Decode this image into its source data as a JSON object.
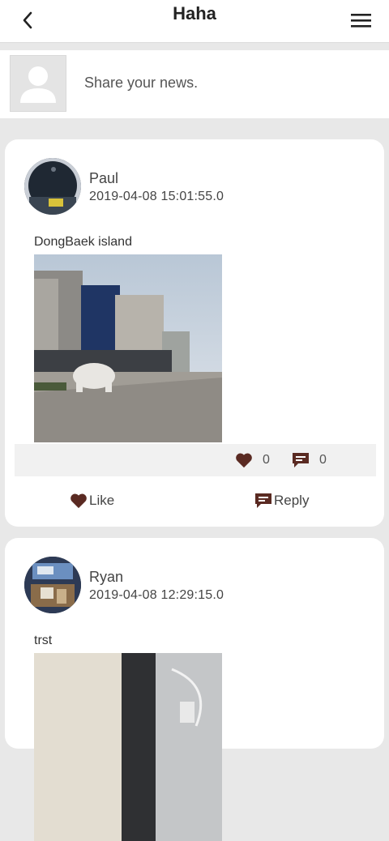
{
  "header": {
    "title": "Haha",
    "back_icon": "chevron-left-icon",
    "menu_icon": "hamburger-menu-icon"
  },
  "share": {
    "placeholder": "Share your news.",
    "avatar_icon": "user-placeholder-icon"
  },
  "posts": [
    {
      "user": "Paul",
      "timestamp": "2019-04-08 15:01:55.0",
      "text": "DongBaek island",
      "likes": "0",
      "replies": "0",
      "like_label": "Like",
      "reply_label": "Reply"
    },
    {
      "user": "Ryan",
      "timestamp": "2019-04-08 12:29:15.0",
      "text": "trst"
    }
  ],
  "colors": {
    "accent": "#5a2a22",
    "background": "#e8e8e8",
    "card": "#ffffff"
  }
}
